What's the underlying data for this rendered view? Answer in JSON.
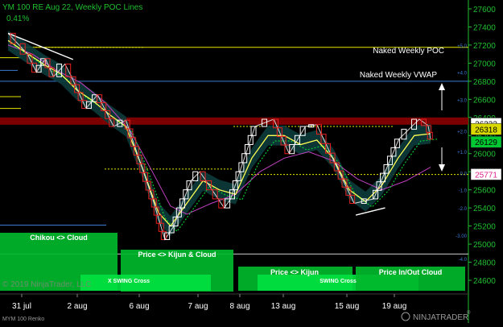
{
  "header": {
    "title": "YM 100 RE Aug 22, Weekly POC Lines",
    "change": "0.41%"
  },
  "footer": {
    "copyright": "© 2019 NinjaTrader, LLC",
    "instrument": "MYM 100 Renko",
    "brand": "NINJATRADER",
    "brand_suffix": "®"
  },
  "colors": {
    "background": "#000000",
    "price_axis": "#1fbf2f",
    "poc_line": "#e6e600",
    "vwap_line": "#3b7bd4",
    "band_fill": "#0d3b3b",
    "up_brick": "#ffffff",
    "down_brick": "#e82020",
    "kijun": "#ffff55",
    "kumo_green": "#00c832",
    "resistance_zone": "#8b0000"
  },
  "annotations": {
    "naked_poc": "Naked Weekly POC",
    "naked_vwap": "Naked Weekly VWAP"
  },
  "panels": [
    {
      "label": "Chikou <> Cloud"
    },
    {
      "label": "Price <> Kijun & Cloud"
    },
    {
      "label": "X SWING Cross"
    },
    {
      "label": "Price <> Kijun"
    },
    {
      "label": "SWING Cross"
    },
    {
      "label": "Price In/Out Cloud"
    }
  ],
  "chart_data": {
    "type": "line",
    "title": "YM 100 RE Aug 22, Weekly POC Lines",
    "x_ticks": [
      "31 jul",
      "2 aug",
      "6 aug",
      "7 aug",
      "8 aug",
      "13 aug",
      "15 aug",
      "19 aug"
    ],
    "y_ticks": [
      24600,
      24800,
      25000,
      25200,
      25400,
      25600,
      25800,
      26000,
      26200,
      26400,
      26600,
      26800,
      27000,
      27200,
      27400,
      27600
    ],
    "ylim": [
      24500,
      27720
    ],
    "std_labels": [
      "+5.0",
      "+4.0",
      "+3.0",
      "+2.0",
      "+1.0",
      "0.0",
      "-1.0",
      "-2.0",
      "-3.00",
      "-4.0"
    ],
    "std_values": [
      27200,
      26900,
      26600,
      26250,
      26025,
      25790,
      25600,
      25400,
      25100,
      24840
    ],
    "price_labels": [
      {
        "text": "26332",
        "value": 26332
      },
      {
        "text": "26318",
        "value": 26270
      },
      {
        "text": "26129",
        "value": 26129
      },
      {
        "text": "25771",
        "value": 25771
      }
    ],
    "naked_weekly_poc": 27175,
    "naked_weekly_vwap": 26800,
    "resistance_zone": [
      26320,
      26400
    ],
    "price_path": [
      [
        0,
        27330
      ],
      [
        2.4,
        27100
      ],
      [
        3.5,
        26900
      ],
      [
        4.6,
        27050
      ],
      [
        5.6,
        26850
      ],
      [
        7.0,
        26990
      ],
      [
        7.8,
        26850
      ],
      [
        9.6,
        26500
      ],
      [
        11.0,
        26650
      ],
      [
        13.0,
        26300
      ],
      [
        14.5,
        26370
      ],
      [
        17.8,
        25500
      ],
      [
        19.3,
        25050
      ],
      [
        20.4,
        25200
      ],
      [
        22.5,
        25700
      ],
      [
        23.6,
        25800
      ],
      [
        26.6,
        25400
      ],
      [
        27.4,
        25500
      ],
      [
        30.4,
        26300
      ],
      [
        32.7,
        26380
      ],
      [
        34.6,
        26000
      ],
      [
        36.6,
        26300
      ],
      [
        38.0,
        26320
      ],
      [
        40.2,
        25900
      ],
      [
        42.6,
        25450
      ],
      [
        45.0,
        25500
      ],
      [
        48.1,
        26160
      ],
      [
        50.6,
        26380
      ],
      [
        51.7,
        26310
      ],
      [
        52.0,
        26160
      ]
    ],
    "kijun_path": [
      [
        0,
        27250
      ],
      [
        2.5,
        27100
      ],
      [
        4.5,
        26980
      ],
      [
        6.5,
        26880
      ],
      [
        8.5,
        26700
      ],
      [
        10.5,
        26580
      ],
      [
        12.5,
        26430
      ],
      [
        14.5,
        26300
      ],
      [
        16.5,
        25850
      ],
      [
        18.5,
        25350
      ],
      [
        20.0,
        25200
      ],
      [
        22.0,
        25450
      ],
      [
        24.0,
        25700
      ],
      [
        26.0,
        25600
      ],
      [
        28.0,
        25550
      ],
      [
        30.0,
        25950
      ],
      [
        32.0,
        26200
      ],
      [
        34.0,
        26200
      ],
      [
        36.0,
        26100
      ],
      [
        38.0,
        26150
      ],
      [
        40.0,
        25950
      ],
      [
        42.0,
        25600
      ],
      [
        44.0,
        25470
      ],
      [
        46.0,
        25650
      ],
      [
        48.0,
        25950
      ],
      [
        50.0,
        26200
      ],
      [
        52.0,
        26220
      ]
    ],
    "slow_path": [
      [
        0,
        27200
      ],
      [
        3,
        27100
      ],
      [
        6,
        26920
      ],
      [
        9,
        26780
      ],
      [
        12,
        26560
      ],
      [
        15,
        26260
      ],
      [
        18,
        25760
      ],
      [
        20,
        25420
      ],
      [
        22,
        25330
      ],
      [
        25,
        25450
      ],
      [
        28,
        25550
      ],
      [
        31,
        25800
      ],
      [
        34,
        25950
      ],
      [
        37,
        26020
      ],
      [
        40,
        25920
      ],
      [
        43,
        25720
      ],
      [
        46,
        25600
      ],
      [
        49,
        25700
      ],
      [
        52,
        25850
      ]
    ],
    "trend_lines": [
      [
        [
          0,
          27330
        ],
        [
          8.0,
          27040
        ]
      ],
      [
        [
          42.8,
          25320
        ],
        [
          46.4,
          25400
        ]
      ]
    ]
  }
}
